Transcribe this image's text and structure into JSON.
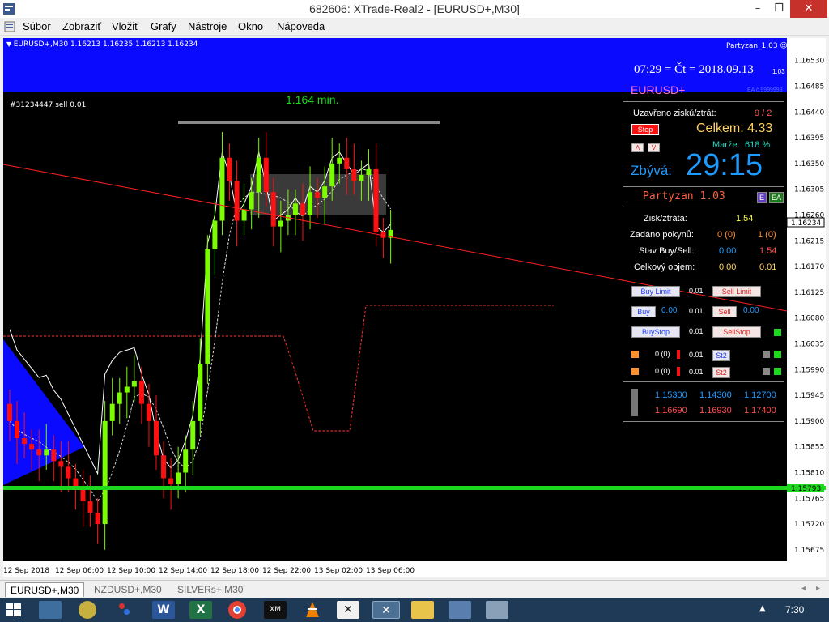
{
  "window": {
    "title": "682606: XTrade-Real2 - [EURUSD+,M30]",
    "min": "–",
    "max": "❐",
    "close": "✕"
  },
  "menu": {
    "items": [
      "Súbor",
      "Zobraziť",
      "Vložiť",
      "Grafy",
      "Nástroje",
      "Okno",
      "Nápoveda"
    ]
  },
  "chart": {
    "symbol_info": "EURUSD+,M30  1.16213 1.16235 1.16213 1.16234",
    "order_label": "#31234447 sell 0.01",
    "timer_label": "1.164 min.",
    "ea_label": "Partyzan_1.03 ☺",
    "price_labels": [
      "1.16530",
      "1.16485",
      "1.16440",
      "1.16395",
      "1.16350",
      "1.16305",
      "1.16260",
      "1.16215",
      "1.16170",
      "1.16125",
      "1.16080",
      "1.16035",
      "1.15990",
      "1.15945",
      "1.15900",
      "1.15855",
      "1.15810",
      "1.15765",
      "1.15720",
      "1.15675"
    ],
    "current_price": "1.16234",
    "green_price": "1.15793",
    "time_labels": [
      "12 Sep 2018",
      "12 Sep 06:00",
      "12 Sep 10:00",
      "12 Sep 14:00",
      "12 Sep 18:00",
      "12 Sep 22:00",
      "13 Sep 02:00",
      "13 Sep 06:00"
    ],
    "colors": {
      "up": "#7cfc00",
      "down": "#ff1010",
      "bg": "#000000",
      "blue": "#0a0aff",
      "hline": "#1ed81e"
    }
  },
  "chart_data": {
    "type": "candlestick",
    "symbol": "EURUSD+",
    "timeframe": "M30",
    "ylim": [
      1.15655,
      1.16555
    ],
    "candles_close_approx": [
      1.159,
      1.1587,
      1.1586,
      1.1585,
      1.1584,
      1.1585,
      1.1583,
      1.1582,
      1.158,
      1.1578,
      1.1576,
      1.1574,
      1.1572,
      1.159,
      1.1593,
      1.1595,
      1.1596,
      1.1597,
      1.1593,
      1.159,
      1.1584,
      1.158,
      1.1579,
      1.1581,
      1.1585,
      1.159,
      1.16,
      1.162,
      1.1625,
      1.1636,
      1.1632,
      1.1625,
      1.1627,
      1.163,
      1.1636,
      1.163,
      1.1624,
      1.1625,
      1.1626,
      1.1628,
      1.1626,
      1.163,
      1.1629,
      1.1631,
      1.1635,
      1.1636,
      1.1634,
      1.1632,
      1.1633,
      1.1634,
      1.1623,
      1.1622,
      1.16234
    ]
  },
  "panel": {
    "clock": "07:29 = Čt = 2018.09.13",
    "clock_sub": "1.03",
    "symbol": "EURUSD+",
    "ea_small": "EA č.9999998",
    "closed_label": "Uzavřeno zisků/ztrát:",
    "closed_value": "9 / 2",
    "stop_btn": "Stop",
    "total_label": "Celkem: 4.33",
    "margin_label": "Marže:",
    "margin_value": "618 %",
    "remaining_label": "Zbývá:",
    "remaining_value": "29:15",
    "ea_name": "Partyzan 1.03",
    "e_btn": "E",
    "ea_btn": "EA",
    "pl_label": "Zisk/ztráta:",
    "pl_value": "1.54",
    "orders_label": "Zadáno pokynů:",
    "orders_buy": "0 (0)",
    "orders_sell": "1 (0)",
    "state_label": "Stav Buy/Sell:",
    "state_buy": "0.00",
    "state_sell": "1.54",
    "volume_label": "Celkový objem:",
    "volume_buy": "0.00",
    "volume_sell": "0.01",
    "buy_limit": "Buy Limit",
    "sell_limit": "Sell Limit",
    "buy": "Buy",
    "sell": "Sell",
    "buy_stop": "BuyStop",
    "sell_stop": "SellStop",
    "lot": "0.01",
    "buy_price": "0.00",
    "sell_price": "0.00",
    "row_a_count": "0 (0)",
    "row_b_count": "0 (0)",
    "st2": "St2",
    "levels_blue": [
      "1.15300",
      "1.14300",
      "1.12700"
    ],
    "levels_red": [
      "1.16690",
      "1.16930",
      "1.17400"
    ]
  },
  "tabs": [
    {
      "label": "EURUSD+,M30",
      "active": true
    },
    {
      "label": "NZDUSD+,M30",
      "active": false
    },
    {
      "label": "SILVERs+,M30",
      "active": false
    }
  ],
  "taskbar": {
    "time": "7:30"
  }
}
